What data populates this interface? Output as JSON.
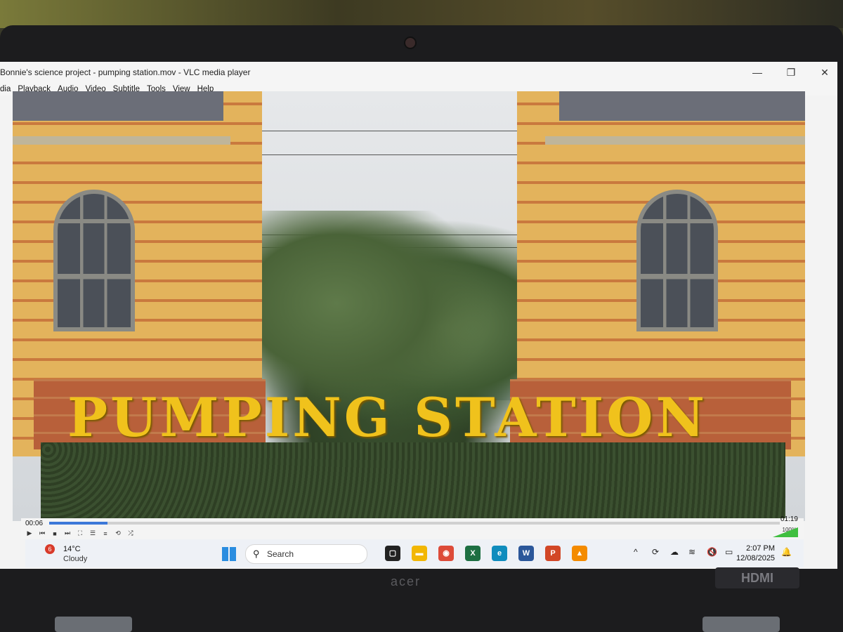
{
  "window": {
    "title": "Bonnie's science project - pumping station.mov - VLC media player",
    "minimize": "—",
    "restore": "❐",
    "close": "✕"
  },
  "menu": [
    "dia",
    "Playback",
    "Audio",
    "Video",
    "Subtitle",
    "Tools",
    "View",
    "Help"
  ],
  "video": {
    "caption": "PUMPING STATION"
  },
  "player": {
    "elapsed": "00:06",
    "duration": "01:19",
    "progress_fraction": 0.08,
    "volume_label": "100%",
    "volume_fraction": 1.0,
    "buttons": [
      "▶",
      "⏮",
      "■",
      "⏭",
      "⛶",
      "☰",
      "≡",
      "⟲",
      "⤮"
    ]
  },
  "taskbar": {
    "weather_badge": "6",
    "temperature": "14°C",
    "condition": "Cloudy",
    "search_label": "Search",
    "apps": [
      {
        "name": "task-view",
        "glyph": "▢",
        "color": "#222222"
      },
      {
        "name": "file-explorer",
        "glyph": "▬",
        "color": "#f2b705"
      },
      {
        "name": "chrome",
        "glyph": "◉",
        "color": "#dd4b39"
      },
      {
        "name": "excel",
        "glyph": "X",
        "color": "#1d6f42"
      },
      {
        "name": "edge",
        "glyph": "e",
        "color": "#0f8cbd"
      },
      {
        "name": "word",
        "glyph": "W",
        "color": "#2b579a"
      },
      {
        "name": "powerpoint",
        "glyph": "P",
        "color": "#d24726"
      },
      {
        "name": "vlc",
        "glyph": "▲",
        "color": "#f48b00"
      }
    ],
    "tray": [
      "^",
      "⟳",
      "☁",
      "≋",
      "🔇",
      "▭"
    ],
    "time": "2:07 PM",
    "date": "12/08/2025"
  },
  "bezel": {
    "brand": "acer",
    "port_label": "HDMI"
  }
}
